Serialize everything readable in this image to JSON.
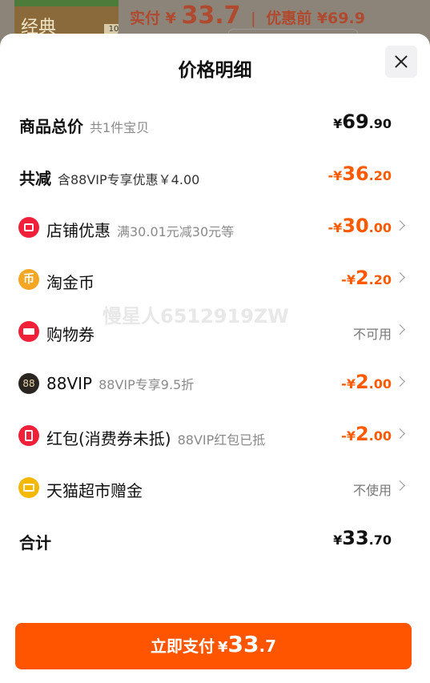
{
  "background": {
    "thumb_text": "经典",
    "thumb_tag": "10",
    "actual_label": "实付",
    "actual_currency": "¥",
    "actual_amount": "33.7",
    "original_label": "优惠前",
    "original_amount": "¥69.9"
  },
  "sheet": {
    "title": "价格明细",
    "close_icon": "close-icon"
  },
  "rows": [
    {
      "label": "商品总价",
      "sub": "共1件宝贝",
      "currency": "¥",
      "int": "69",
      "dec": ".90",
      "color": "#111111"
    },
    {
      "label": "共减",
      "sub": "含88VIP专享优惠￥4.00",
      "currency": "-¥",
      "int": "36",
      "dec": ".20",
      "color": "#ff5a00"
    },
    {
      "label": "店铺优惠",
      "sub": "满30.01元减30元等",
      "currency": "-¥",
      "int": "30",
      "dec": ".00",
      "icon": "shop-coupon-icon",
      "icon_color": "#f0203a"
    },
    {
      "label": "淘金币",
      "sub": "",
      "currency": "-¥",
      "int": "2",
      "dec": ".20",
      "icon": "gold-coin-icon",
      "icon_color": "#f5a623",
      "icon_glyph": "币"
    },
    {
      "label": "购物券",
      "sub": "",
      "status": "不可用",
      "icon": "shopping-voucher-icon",
      "icon_color": "#f0203a"
    },
    {
      "label": "88VIP",
      "sub": "88VIP专享9.5折",
      "currency": "-¥",
      "int": "2",
      "dec": ".00",
      "icon": "vip-88-icon",
      "icon_color": "#2a2520",
      "icon_glyph": "88"
    },
    {
      "label": "红包(消费券未抵)",
      "sub": "88VIP红包已抵",
      "currency": "-¥",
      "int": "2",
      "dec": ".00",
      "icon": "red-packet-icon",
      "icon_color": "#f0203a"
    },
    {
      "label": "天猫超市赠金",
      "sub": "",
      "status": "不使用",
      "icon": "tmall-gift-icon",
      "icon_color": "#f5b800"
    },
    {
      "label": "合计",
      "sub": "",
      "currency": "¥",
      "int": "33",
      "dec": ".70",
      "color": "#111111"
    }
  ],
  "watermark": "慢星人6512919ZW",
  "pay_button": {
    "label": "立即支付",
    "currency": "¥",
    "int": "33",
    "dec": ".7",
    "color": "#ff5500"
  }
}
